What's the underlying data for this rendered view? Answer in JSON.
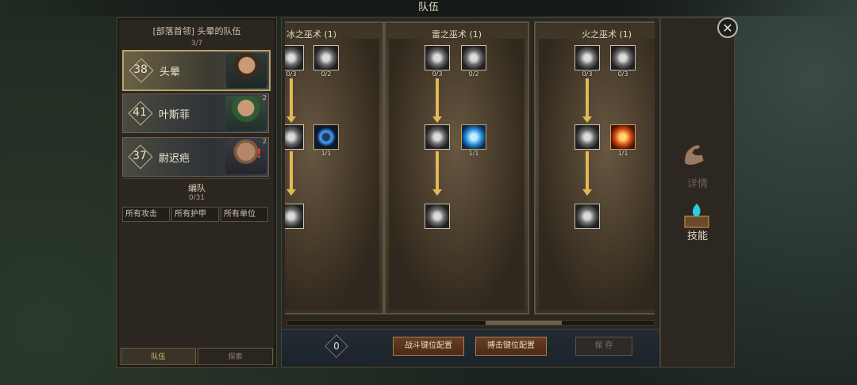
{
  "title": "队伍",
  "left_panel": {
    "header": "[部落首领] 头晕的队伍",
    "count": "3/7",
    "units": [
      {
        "level": "38",
        "name": "头晕",
        "badge": ""
      },
      {
        "level": "41",
        "name": "叶斯菲",
        "badge": "2"
      },
      {
        "level": "37",
        "name": "尉迟疤",
        "badge": "2"
      }
    ],
    "formation_title": "编队",
    "formation_count": "0/31",
    "filters": [
      "所有攻击",
      "所有护甲",
      "所有单位"
    ],
    "tabs": [
      "队伍",
      "探索"
    ]
  },
  "columns": [
    {
      "title": "冰之巫术 (1)",
      "counts": [
        "0/3",
        "0/2",
        "1/1"
      ]
    },
    {
      "title": "雷之巫术 (1)",
      "counts": [
        "0/3",
        "0/2",
        "1/1"
      ]
    },
    {
      "title": "火之巫术 (1)",
      "counts": [
        "0/3",
        "0/3",
        "1/1"
      ]
    }
  ],
  "footer": {
    "points": "0",
    "battle_keys": "战斗键位配置",
    "capture_keys": "搏击键位配置",
    "save": "保 存"
  },
  "right_nav": {
    "details": "详情",
    "skills": "技能"
  },
  "colors": {
    "accent": "#e2b957",
    "selected_border": "#b8a56a",
    "alert": "#e23a2a"
  }
}
